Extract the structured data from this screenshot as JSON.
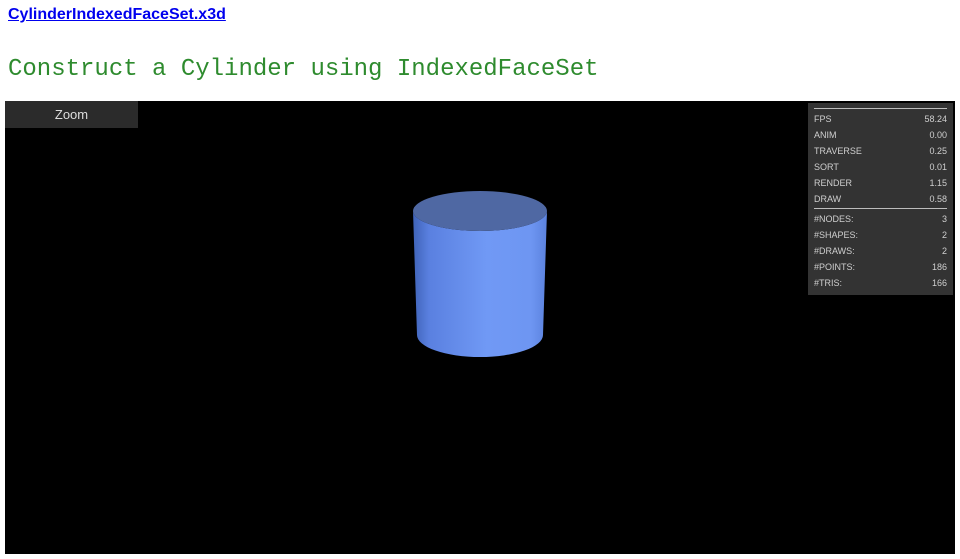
{
  "page": {
    "file_link": "CylinderIndexedFaceSet.x3d",
    "heading": "Construct a Cylinder using IndexedFaceSet"
  },
  "viewer": {
    "nav_mode": "Zoom",
    "colors": {
      "background": "#000000",
      "cylinder_side": "#6f95f2",
      "cylinder_top": "#4f68a3",
      "stats_panel": "#333333"
    },
    "stats": {
      "timing": [
        {
          "label": "FPS",
          "value": "58.24"
        },
        {
          "label": "ANIM",
          "value": "0.00"
        },
        {
          "label": "TRAVERSE",
          "value": "0.25"
        },
        {
          "label": "SORT",
          "value": "0.01"
        },
        {
          "label": "RENDER",
          "value": "1.15"
        },
        {
          "label": "DRAW",
          "value": "0.58"
        }
      ],
      "counts": [
        {
          "label": "#NODES:",
          "value": "3"
        },
        {
          "label": "#SHAPES:",
          "value": "2"
        },
        {
          "label": "#DRAWS:",
          "value": "2"
        },
        {
          "label": "#POINTS:",
          "value": "186"
        },
        {
          "label": "#TRIS:",
          "value": "166"
        }
      ]
    }
  }
}
